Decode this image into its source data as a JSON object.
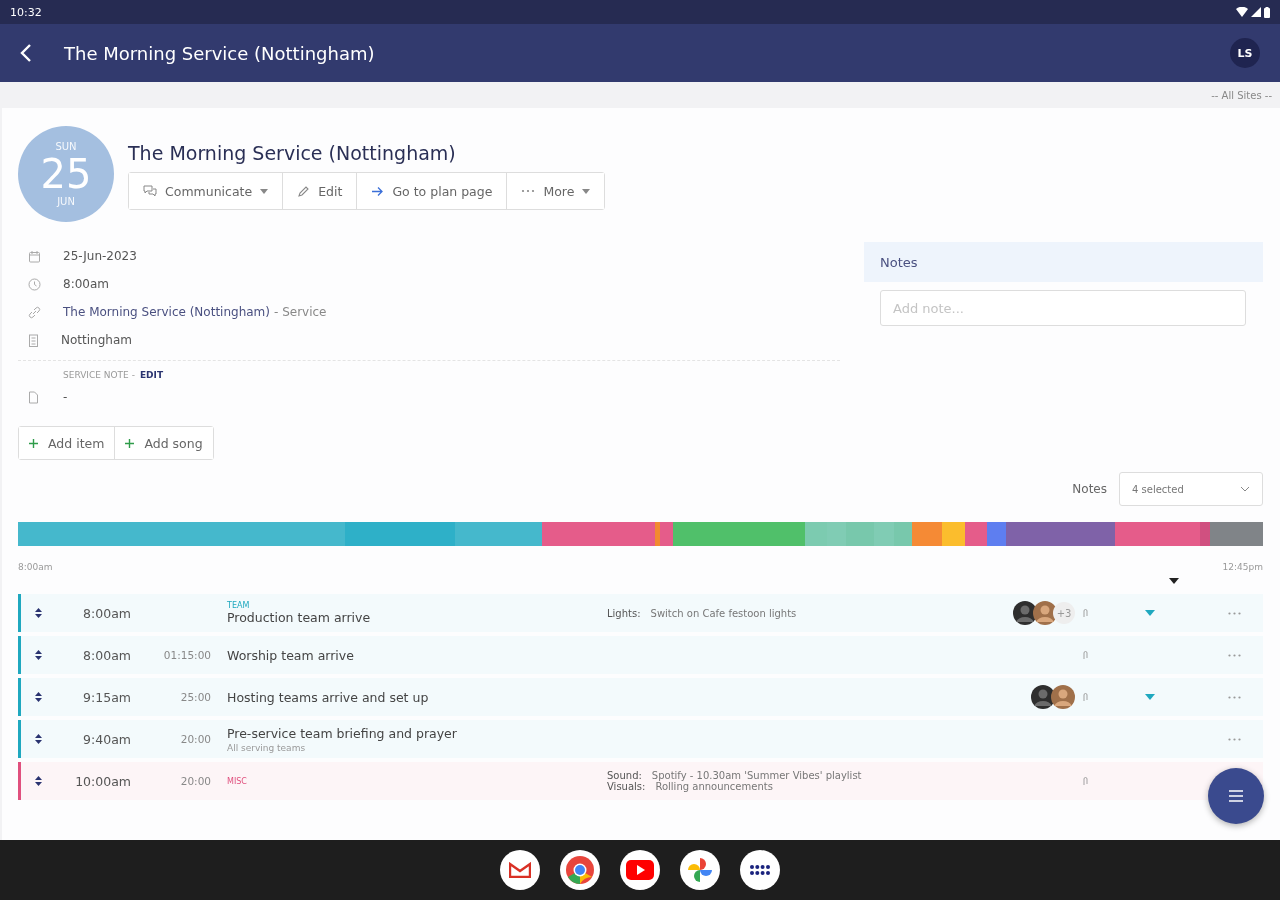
{
  "status_bar": {
    "time": "10:32"
  },
  "app_bar": {
    "title": "The Morning Service (Nottingham)",
    "avatar": "LS"
  },
  "site_filter": "-- All Sites --",
  "event": {
    "weekday": "SUN",
    "day": "25",
    "month": "JUN",
    "title": "The Morning Service (Nottingham)",
    "actions": [
      {
        "label": "Communicate",
        "kind": "chat"
      },
      {
        "label": "Edit",
        "kind": "edit"
      },
      {
        "label": "Go to plan page",
        "kind": "go"
      },
      {
        "label": "More",
        "kind": "more"
      }
    ],
    "details": [
      {
        "kind": "date",
        "text": "25-Jun-2023"
      },
      {
        "kind": "time",
        "text": "8:00am"
      },
      {
        "kind": "link",
        "text": "The Morning Service (Nottingham)",
        "suffix": "- Service"
      },
      {
        "kind": "site",
        "text": "Nottingham"
      }
    ],
    "service_note": {
      "label": "SERVICE NOTE -",
      "action": "EDIT",
      "text": "-"
    },
    "add_buttons": [
      "Add item",
      "Add song"
    ]
  },
  "notes_panel": {
    "title": "Notes",
    "placeholder": "Add note..."
  },
  "notes_filter": {
    "label": "Notes",
    "value": "4 selected"
  },
  "timeline": {
    "start": "8:00am",
    "end": "12:45pm"
  },
  "rows": [
    {
      "time": "8:00am",
      "category": "TEAM",
      "title": "Production team arrive",
      "color": "#1fa8bf",
      "notes": [
        {
          "label": "Lights:",
          "text": "Switch on Cafe festoon lights"
        }
      ],
      "avatars": [
        {
          "kind": "picture"
        },
        {
          "kind": "picture"
        }
      ],
      "more_people": "+3",
      "attachment": true,
      "expandable": true
    },
    {
      "time": "8:00am",
      "duration": "01:15:00",
      "title": "Worship team arrive",
      "color": "#1fa8bf",
      "attachment": true,
      "expandable": false
    },
    {
      "time": "9:15am",
      "duration": "25:00",
      "title": "Hosting teams arrive and set up",
      "color": "#1fa8bf",
      "avatars": [
        {
          "kind": "picture"
        },
        {
          "kind": "picture"
        }
      ],
      "attachment": true,
      "expandable": true
    },
    {
      "time": "9:40am",
      "duration": "20:00",
      "title": "Pre-service team briefing and prayer",
      "subtitle": "All serving teams",
      "color": "#1fa8bf",
      "attachment": false,
      "expandable": false
    },
    {
      "time": "10:00am",
      "duration": "20:00",
      "category": "MISC",
      "color": "#e0507e",
      "notes": [
        {
          "label": "Sound:",
          "text": "Spotify - 10.30am 'Summer Vibes' playlist"
        },
        {
          "label": "Visuals:",
          "text": "Rolling announcements"
        }
      ],
      "attachment": true,
      "expandable": false
    }
  ]
}
